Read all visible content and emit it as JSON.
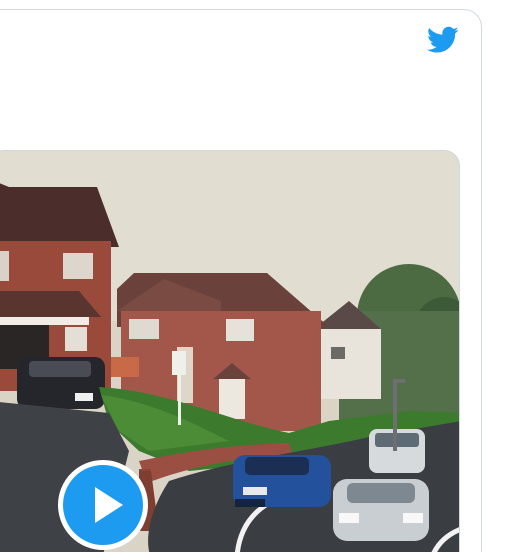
{
  "tweet": {
    "brand_icon": "twitter-bird-icon",
    "brand_color": "#1d9bf0",
    "media": {
      "type": "video",
      "play_icon": "play-icon",
      "description_icon": "video-thumbnail"
    }
  },
  "colors": {
    "accent": "#1d9bf0",
    "border": "#cfd9de",
    "background": "#ffffff"
  }
}
